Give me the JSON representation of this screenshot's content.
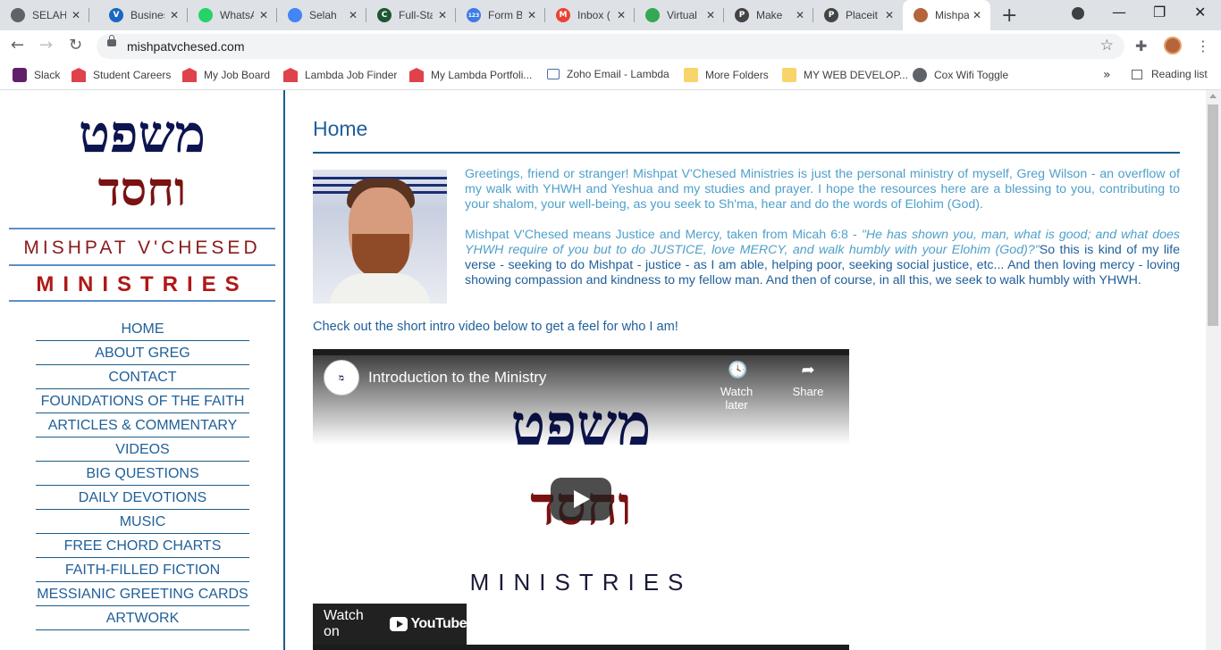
{
  "browser": {
    "tabs": [
      {
        "title": "SELAH",
        "icon": "globe-icon",
        "color": "#5f6368",
        "glyph": ""
      },
      {
        "title": "Business",
        "icon": "vuetify-icon",
        "color": "#1867c0",
        "glyph": "V"
      },
      {
        "title": "WhatsApp",
        "icon": "whatsapp-icon",
        "color": "#25d366",
        "glyph": ""
      },
      {
        "title": "Selah",
        "icon": "docs-icon",
        "color": "#4285f4",
        "glyph": ""
      },
      {
        "title": "Full-Stack",
        "icon": "codewars-icon",
        "color": "#1e5631",
        "glyph": "C"
      },
      {
        "title": "Form B",
        "icon": "form-icon",
        "color": "#3d7ce7",
        "glyph": "123"
      },
      {
        "title": "Inbox (",
        "icon": "gmail-icon",
        "color": "#ea4335",
        "glyph": "M"
      },
      {
        "title": "Virtual",
        "icon": "virtual-icon",
        "color": "#34a853",
        "glyph": ""
      },
      {
        "title": "Make",
        "icon": "pluralsight-icon",
        "color": "#444444",
        "glyph": "P"
      },
      {
        "title": "Placeit",
        "icon": "placeit-icon",
        "color": "#444444",
        "glyph": "P"
      },
      {
        "title": "Mishpat",
        "icon": "profile-favicon-icon",
        "color": "#b5653a",
        "glyph": ""
      }
    ],
    "url": "mishpatvchesed.com",
    "bookmarks": [
      {
        "label": "Slack",
        "kind": "slack"
      },
      {
        "label": "Student Careers",
        "kind": "lambda"
      },
      {
        "label": "My Job Board",
        "kind": "lambda"
      },
      {
        "label": "Lambda Job Finder",
        "kind": "lambda"
      },
      {
        "label": "My Lambda Portfoli...",
        "kind": "lambda"
      },
      {
        "label": "Zoho Email - Lambda",
        "kind": "zoho"
      },
      {
        "label": "More Folders",
        "kind": "folder"
      },
      {
        "label": "MY WEB DEVELOP...",
        "kind": "folder"
      },
      {
        "label": "Cox Wifi Toggle",
        "kind": "globe"
      }
    ],
    "more": "»",
    "reading_list": "Reading list"
  },
  "site": {
    "logo": {
      "hebrew_line1": "משפט",
      "hebrew_line2": "וחסד",
      "name_line": "MISHPAT V'CHESED",
      "ministries": "MINISTRIES"
    },
    "nav": [
      "HOME",
      "ABOUT GREG",
      "CONTACT",
      "FOUNDATIONS OF THE FAITH",
      "ARTICLES & COMMENTARY",
      "VIDEOS",
      "BIG QUESTIONS",
      "DAILY DEVOTIONS",
      "MUSIC",
      "FREE CHORD CHARTS",
      "FAITH-FILLED FICTION",
      "MESSIANIC GREETING CARDS",
      "ARTWORK"
    ],
    "page_title": "Home",
    "intro_p1": "Greetings, friend or stranger! Mishpat V'Chesed Ministries is just the personal ministry of myself, Greg Wilson - an overflow of my walk with YHWH and Yeshua and my studies and prayer. I hope the resources here are a blessing to you, contributing to your shalom, your well-being, as you seek to Sh'ma, hear and do the words of Elohim (God).",
    "intro_p2_start": "Mishpat V'Chesed means Justice and Mercy, taken from Micah 6:8 - ",
    "intro_p2_quote": "\"He has shown you, man, what is good; and what does YHWH require of you but to do JUSTICE, love MERCY, and walk humbly with your Elohim (God)?\"",
    "intro_p2_dark": "So this is kind",
    "intro_p2_end": " of my life verse - seeking to do Mishpat - justice - as I am able, helping poor, seeking social justice, etc... And then loving mercy - loving showing compassion and kindness to my fellow man. And then of course, in all this, we seek to walk humbly with YHWH.",
    "check_out": "Check out the short intro video below to get a feel for who I am!",
    "video": {
      "title": "Introduction to the Ministry",
      "channel_glyph": "מ",
      "watch_later": "Watch later",
      "share": "Share",
      "hebrew_line1": "משפט",
      "hebrew_line2": "וחסד",
      "ministries": "MINISTRIES",
      "watch_on": "Watch on",
      "youtube": "YouTube"
    }
  }
}
